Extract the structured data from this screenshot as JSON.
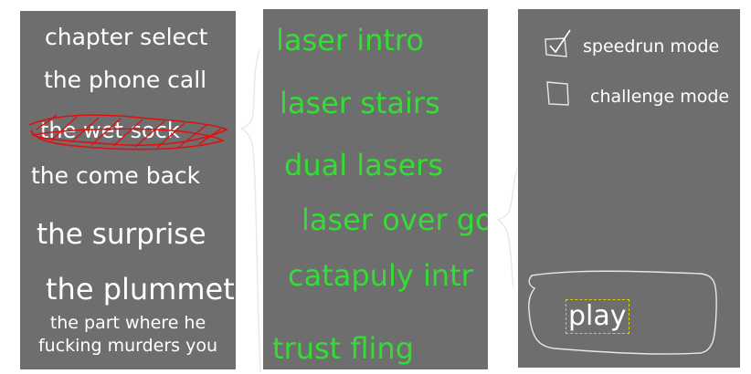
{
  "chapters": {
    "items": [
      {
        "label": "chapter select"
      },
      {
        "label": "the phone call"
      },
      {
        "label": "the wet sock",
        "status": "scribbled-out"
      },
      {
        "label": "the come back"
      },
      {
        "label": "the surprise"
      },
      {
        "label": "the plummet"
      },
      {
        "label": "the part where he\nfucking murders you"
      }
    ]
  },
  "levels": {
    "items": [
      {
        "label": "laser intro"
      },
      {
        "label": "laser stairs"
      },
      {
        "label": "dual lasers"
      },
      {
        "label": "laser over go"
      },
      {
        "label": "catapuly intr"
      },
      {
        "label": "trust fling"
      }
    ]
  },
  "modes": {
    "speedrun": {
      "label": "speedrun mode",
      "checked": true,
      "icon": "checkbox-checked-icon"
    },
    "challenge": {
      "label": "challenge mode",
      "checked": false,
      "icon": "checkbox-empty-icon"
    }
  },
  "play": {
    "label": "play"
  },
  "colors": {
    "panel": "#6e6e6e",
    "chapter_text": "#ffffff",
    "level_text": "#33dd33",
    "scribble": "#dd1111",
    "play_highlight": "#d4d400"
  }
}
